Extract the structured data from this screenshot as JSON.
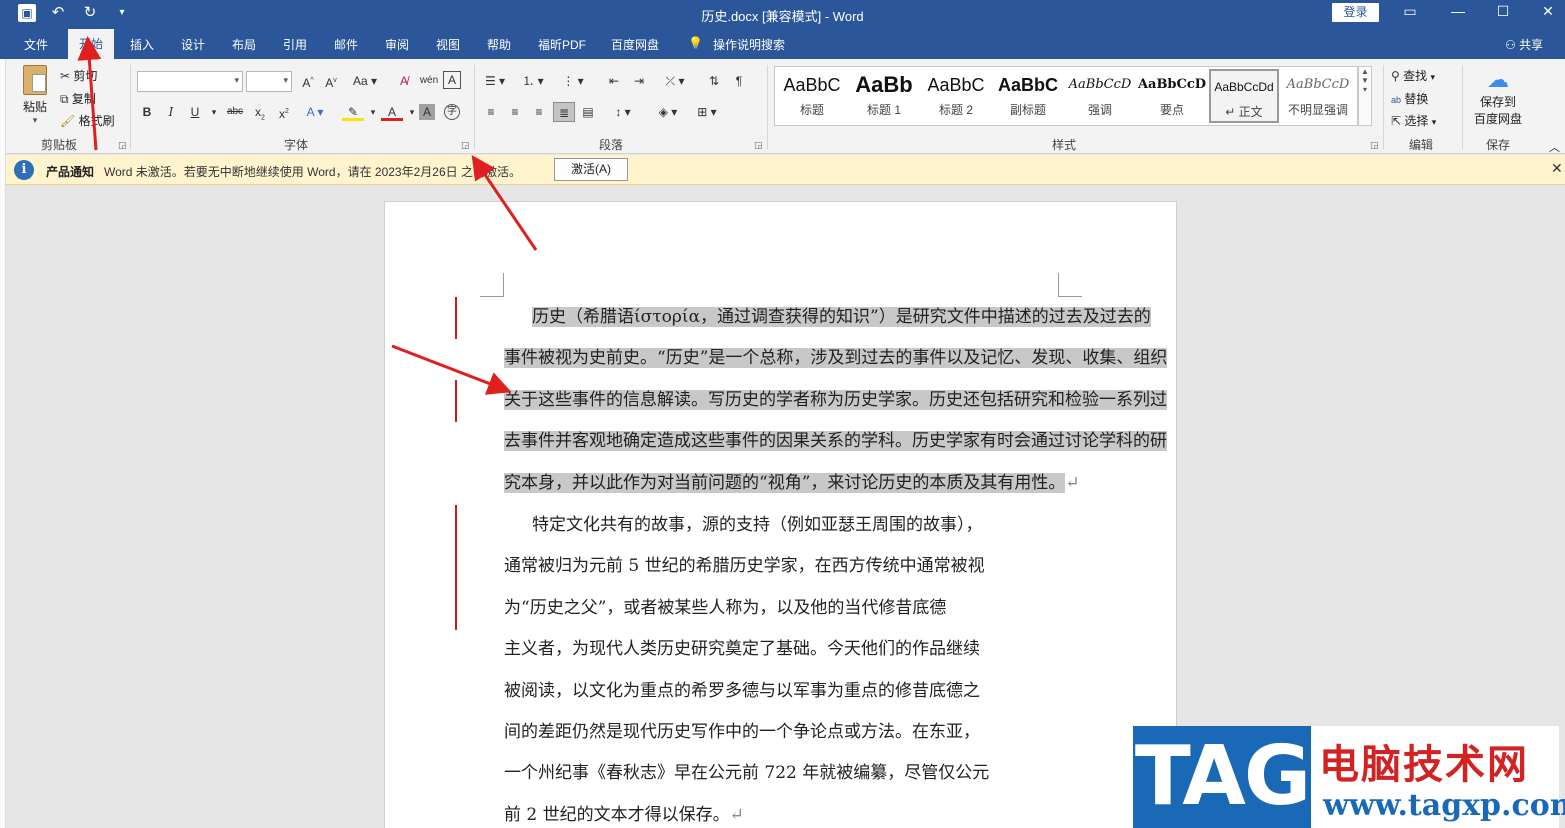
{
  "titlebar": {
    "title": "历史.docx [兼容模式]  -  Word",
    "login_label": "登录",
    "qat": {
      "save_icon": "save-icon",
      "undo_icon": "undo-icon",
      "redo_icon": "redo-icon",
      "customize_icon": "dropdown-icon"
    }
  },
  "tabs": {
    "file": "文件",
    "home": "开始",
    "insert": "插入",
    "design": "设计",
    "layout": "布局",
    "references": "引用",
    "mailings": "邮件",
    "review": "审阅",
    "view": "视图",
    "help": "帮助",
    "foxit": "福昕PDF",
    "baidu": "百度网盘",
    "tellme": "操作说明搜索",
    "share": "共享"
  },
  "ribbon": {
    "clipboard": {
      "paste": "粘贴",
      "cut": "剪切",
      "copy": "复制",
      "format_painter": "格式刷",
      "label": "剪贴板"
    },
    "font": {
      "font_name": "",
      "font_size": "",
      "label": "字体"
    },
    "paragraph": {
      "label": "段落"
    },
    "styles": {
      "label": "样式",
      "items": [
        {
          "sample": "AaBbC",
          "name": "标题"
        },
        {
          "sample": "AaBb",
          "name": "标题 1"
        },
        {
          "sample": "AaBbC",
          "name": "标题 2"
        },
        {
          "sample": "AaBbC",
          "name": "副标题"
        },
        {
          "sample": "AaBbCcD",
          "name": "强调"
        },
        {
          "sample": "AaBbCcD",
          "name": "要点"
        },
        {
          "sample": "AaBbCcDd",
          "name": "↵ 正文"
        },
        {
          "sample": "AaBbCcD",
          "name": "不明显强调"
        }
      ]
    },
    "editing": {
      "find": "查找",
      "replace": "替换",
      "select": "选择",
      "label": "编辑"
    },
    "save": {
      "save_to_baidu_line1": "保存到",
      "save_to_baidu_line2": "百度网盘",
      "label": "保存"
    }
  },
  "notice": {
    "label": "产品通知",
    "message": "Word 未激活。若要无中断地继续使用 Word，请在 2023年2月26日 之前激活。",
    "activate_button": "激活(A)"
  },
  "document": {
    "para1_lines": [
      "历史（希腊语ίστορία，通过调查获得的知识”）是研究文件中描述的过去及过去的",
      "事件被视为史前史。“历史”是一个总称，涉及到过去的事件以及记忆、发现、收集、组织",
      "关于这些事件的信息解读。写历史的学者称为历史学家。历史还包括研究和检验一系列过",
      "去事件并客观地确定造成这些事件的因果关系的学科。历史学家有时会通过讨论学科的研",
      "究本身，并以此作为对当前问题的“视角”，来讨论历史的本质及其有用性。"
    ],
    "para2_lines": [
      "特定文化共有的故事，源的支持（例如亚瑟王周围的故事），",
      "通常被归为元前 5 世纪的希腊历史学家，在西方传统中通常被视",
      "为“历史之父”，或者被某些人称为，以及他的当代修昔底德",
      "主义者，为现代人类历史研究奠定了基础。今天他们的作品继续",
      "被阅读，以文化为重点的希罗多德与以军事为重点的修昔底德之",
      "间的差距仍然是现代历史写作中的一个争论点或方法。在东亚，",
      "一个州纪事《春秋志》早在公元前 722 年就被编纂，尽管仅公元",
      "前 2 世纪的文本才得以保存。"
    ],
    "paragraph_mark": "↵"
  },
  "watermark": {
    "tag": "TAG",
    "cn": "电脑技术网",
    "url": "www.tagxp.com"
  },
  "colors": {
    "word_blue": "#2b579a",
    "notice_bg": "#fff4ce",
    "arrow_red": "#e02020",
    "selection_gray": "#c8c8c8"
  }
}
